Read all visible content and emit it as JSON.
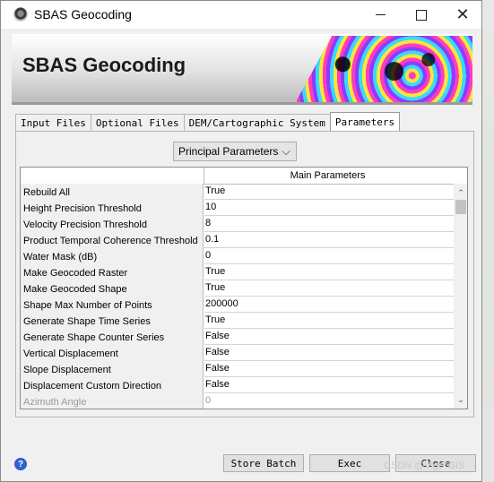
{
  "window": {
    "title": "SBAS Geocoding",
    "minimize_icon": "minimize-icon",
    "maximize_icon": "maximize-icon",
    "close_icon": "close-icon",
    "close_glyph": "✕"
  },
  "banner": {
    "title": "SBAS Geocoding"
  },
  "tabs": [
    {
      "label": "Input Files",
      "active": false
    },
    {
      "label": "Optional Files",
      "active": false
    },
    {
      "label": "DEM/Cartographic System",
      "active": false
    },
    {
      "label": "Parameters",
      "active": true
    }
  ],
  "dropdown": {
    "selected": "Principal Parameters",
    "chevron": "⌵"
  },
  "table": {
    "header": "Main Parameters",
    "rows": [
      {
        "name": "Rebuild All",
        "value": "True"
      },
      {
        "name": "Height Precision Threshold",
        "value": "10"
      },
      {
        "name": "Velocity Precision Threshold",
        "value": "8"
      },
      {
        "name": "Product Temporal Coherence Threshold",
        "value": "0.1"
      },
      {
        "name": "Water Mask (dB)",
        "value": "0"
      },
      {
        "name": "Make Geocoded Raster",
        "value": "True"
      },
      {
        "name": "Make Geocoded Shape",
        "value": "True"
      },
      {
        "name": "Shape Max Number of Points",
        "value": "200000"
      },
      {
        "name": "Generate Shape Time Series",
        "value": "True"
      },
      {
        "name": "Generate Shape Counter Series",
        "value": "False"
      },
      {
        "name": "Vertical Displacement",
        "value": "False"
      },
      {
        "name": "Slope Displacement",
        "value": "False"
      },
      {
        "name": "Displacement Custom Direction",
        "value": "False"
      },
      {
        "name": "Azimuth Angle",
        "value": "0"
      }
    ],
    "scroll_up_glyph": "⌃",
    "scroll_down_glyph": "⌄"
  },
  "buttons": {
    "store_batch": "Store Batch",
    "exec": "Exec",
    "close": "Close"
  },
  "help": {
    "glyph": "?"
  },
  "watermark": "CSDN @Vigo*GIS"
}
